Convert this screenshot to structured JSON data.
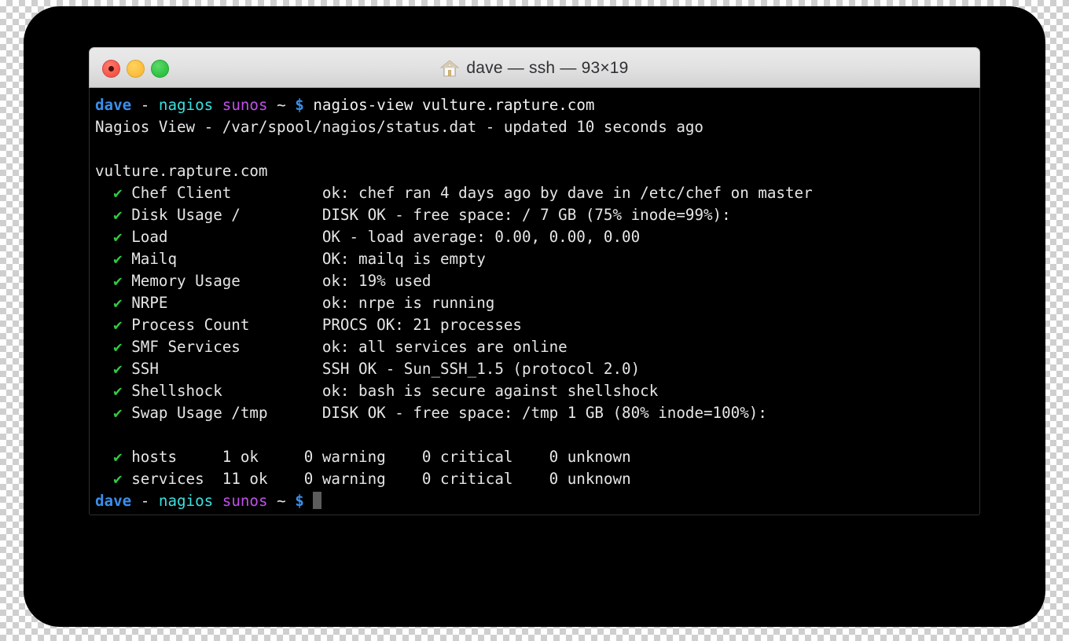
{
  "window": {
    "title": "dave — ssh — 93×19",
    "icon": "home-icon",
    "controls": {
      "close_label": "",
      "minimize_label": "",
      "maximize_label": ""
    }
  },
  "colors": {
    "background": "#000000",
    "foreground": "#e6e6e6",
    "user": "#3b8eea",
    "host": "#3ae0e0",
    "os": "#c050e8",
    "dollar": "#3b8eea",
    "ok_check": "#2ecc40",
    "cursor": "#5c5c5c",
    "titlebar_top": "#eaeaea",
    "titlebar_bottom": "#d2d2d2",
    "traffic_red": "#f75a4e",
    "traffic_yellow": "#fcbf3f",
    "traffic_green": "#32c546"
  },
  "prompt": {
    "user": "dave",
    "separator": "-",
    "host": "nagios",
    "os": "sunos",
    "cwd": "~",
    "symbol": "$"
  },
  "session": {
    "command": "nagios-view vulture.rapture.com",
    "status_line": "Nagios View - /var/spool/nagios/status.dat - updated 10 seconds ago",
    "hostname": "vulture.rapture.com",
    "check_glyph": "✔",
    "services": [
      {
        "state": "ok",
        "name": "Chef Client",
        "status": "ok: chef ran 4 days ago by dave in /etc/chef on master"
      },
      {
        "state": "ok",
        "name": "Disk Usage /",
        "status": "DISK OK - free space: / 7 GB (75% inode=99%):"
      },
      {
        "state": "ok",
        "name": "Load",
        "status": "OK - load average: 0.00, 0.00, 0.00"
      },
      {
        "state": "ok",
        "name": "Mailq",
        "status": "OK: mailq is empty"
      },
      {
        "state": "ok",
        "name": "Memory Usage",
        "status": "ok: 19% used"
      },
      {
        "state": "ok",
        "name": "NRPE",
        "status": "ok: nrpe is running"
      },
      {
        "state": "ok",
        "name": "Process Count",
        "status": "PROCS OK: 21 processes"
      },
      {
        "state": "ok",
        "name": "SMF Services",
        "status": "ok: all services are online"
      },
      {
        "state": "ok",
        "name": "SSH",
        "status": "SSH OK - Sun_SSH_1.5 (protocol 2.0)"
      },
      {
        "state": "ok",
        "name": "Shellshock",
        "status": "ok: bash is secure against shellshock"
      },
      {
        "state": "ok",
        "name": "Swap Usage /tmp",
        "status": "DISK OK - free space: /tmp 1 GB (80% inode=100%):"
      }
    ],
    "summary": [
      {
        "label": "hosts",
        "ok": "1 ok",
        "warning": "0 warning",
        "critical": "0 critical",
        "unknown": "0 unknown"
      },
      {
        "label": "services",
        "ok": "11 ok",
        "warning": "0 warning",
        "critical": "0 critical",
        "unknown": "0 unknown"
      }
    ]
  }
}
